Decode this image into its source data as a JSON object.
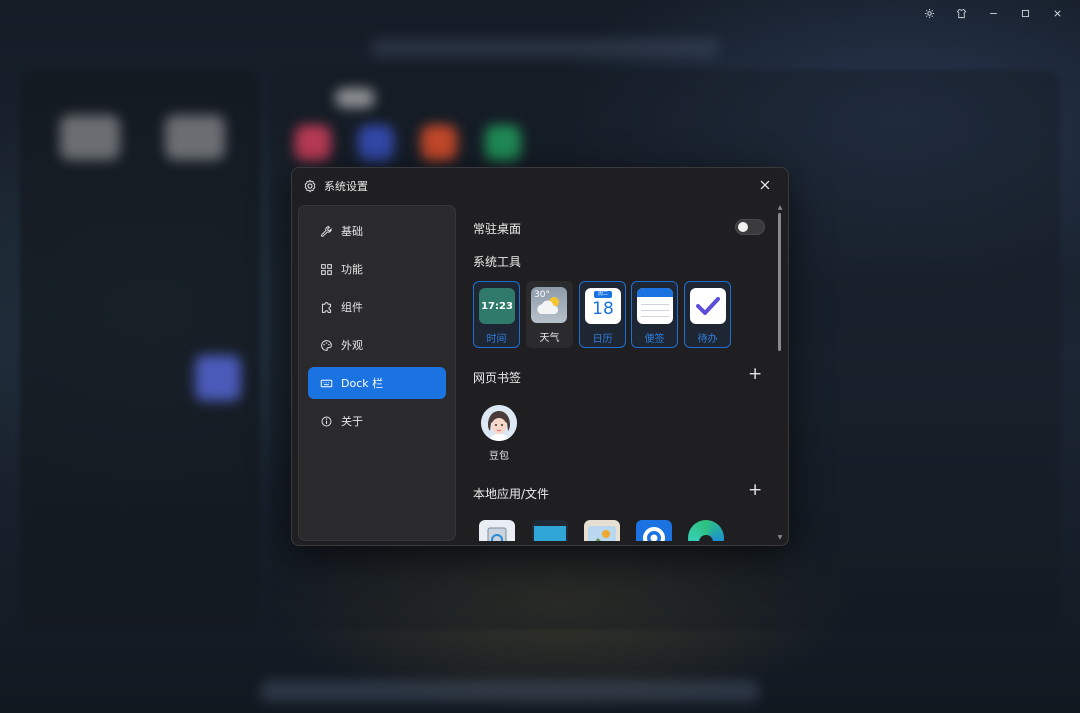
{
  "window_controls": [
    "gear-icon",
    "shirt-icon",
    "minimize-icon",
    "maximize-icon",
    "close-icon"
  ],
  "dialog": {
    "title": "系统设置",
    "title_icon": "gear-icon",
    "close_icon": "close-icon"
  },
  "sidebar": {
    "items": [
      {
        "label": "基础",
        "icon": "wrench-icon"
      },
      {
        "label": "功能",
        "icon": "grid-icon"
      },
      {
        "label": "组件",
        "icon": "puzzle-icon"
      },
      {
        "label": "外观",
        "icon": "palette-icon"
      },
      {
        "label": "Dock 栏",
        "icon": "keyboard-icon",
        "active": true
      },
      {
        "label": "关于",
        "icon": "info-icon"
      }
    ]
  },
  "content": {
    "pin_desktop": {
      "label": "常驻桌面",
      "enabled": false
    },
    "system_tools": {
      "label": "系统工具",
      "items": [
        {
          "label": "时间",
          "icon_text": "17:23",
          "icon": "clock-icon",
          "selected": true
        },
        {
          "label": "天气",
          "icon_text": "30°",
          "icon": "weather-icon",
          "selected": false
        },
        {
          "label": "日历",
          "icon_text": "18",
          "icon_header": "周二",
          "icon": "calendar-icon",
          "selected": true
        },
        {
          "label": "便签",
          "icon": "notes-icon",
          "selected": true
        },
        {
          "label": "待办",
          "icon": "todo-check-icon",
          "selected": true
        }
      ]
    },
    "bookmarks": {
      "label": "网页书签",
      "add_icon": "plus-icon",
      "items": [
        {
          "label": "豆包",
          "icon": "doubao-avatar-icon"
        }
      ]
    },
    "local_apps": {
      "label": "本地应用/文件",
      "add_icon": "plus-icon",
      "items": [
        {
          "icon": "recycle-bin-icon"
        },
        {
          "icon": "monitor-icon"
        },
        {
          "icon": "photos-app-icon"
        },
        {
          "icon": "settings-app-icon"
        },
        {
          "icon": "edge-browser-icon"
        }
      ]
    }
  },
  "colors": {
    "accent": "#1a73e0",
    "dialog_bg": "#1f1f21",
    "sidebar_bg": "#2a2a2c",
    "selected_border": "#1f6fd0"
  }
}
